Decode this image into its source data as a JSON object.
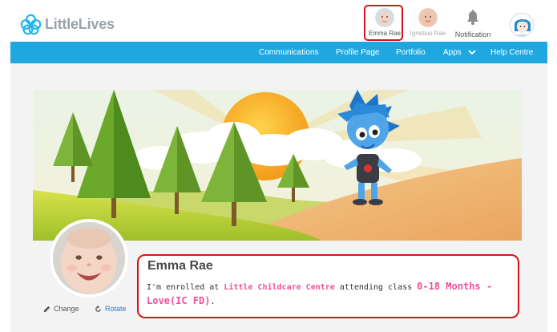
{
  "header": {
    "logo_text": "LittleLives",
    "children": [
      {
        "name": "Emma Rae",
        "selected": true
      },
      {
        "name": "Ignatius Rae",
        "selected": false
      }
    ],
    "notification_label": "Notification"
  },
  "nav": {
    "items": [
      {
        "label": "Communications"
      },
      {
        "label": "Profile Page"
      },
      {
        "label": "Portfolio"
      },
      {
        "label": "Apps"
      },
      {
        "label": "Help Centre"
      }
    ]
  },
  "profile": {
    "name": "Emma Rae",
    "intro": "I'm enrolled at ",
    "school": "Little Childcare Centre",
    "mid": " attending class ",
    "class_name": "0-18 Months - Love(IC FD)",
    "end": ".",
    "change_label": "Change",
    "rotate_label": "Rotate"
  },
  "colors": {
    "nav_bg": "#1fa8e0",
    "accent_pink": "#f0509a",
    "highlight_red": "#d4141c"
  },
  "icons": {
    "logo": "flower-icon",
    "notification": "bell-icon",
    "apps_dropdown": "chevron-down-icon",
    "change": "pencil-icon",
    "rotate": "rotate-icon"
  }
}
